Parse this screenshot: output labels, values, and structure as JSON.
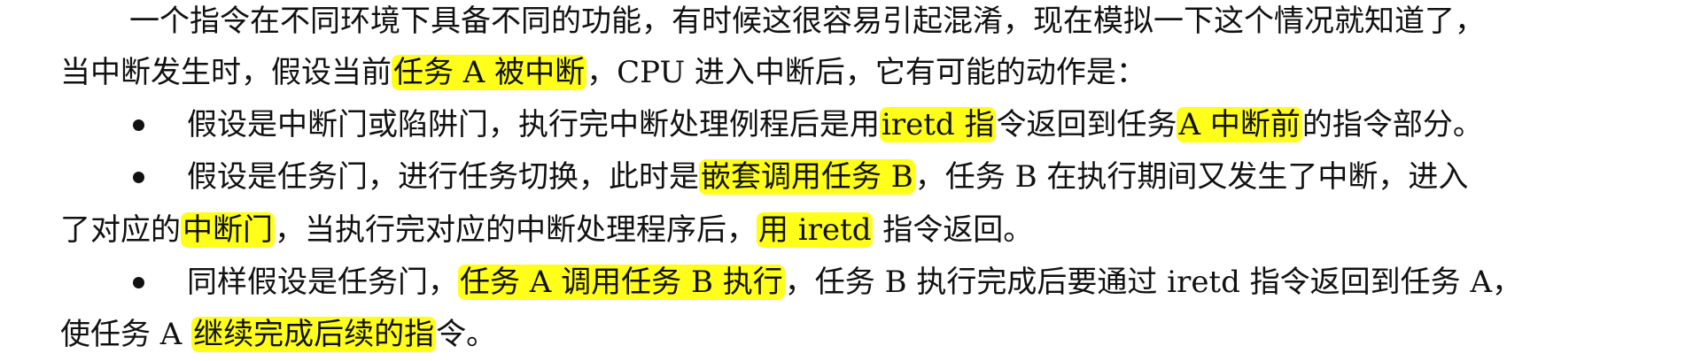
{
  "paragraph": {
    "line1": "一个指令在不同环境下具备不同的功能，有时候这很容易引起混淆，现在模拟一下这个情况就知道了，",
    "line2": {
      "a": "当中断发生时，假设当前",
      "h1": "任务 A 被中断",
      "b": "，CPU 进入中断后，它有可能的动作是："
    }
  },
  "bullets": [
    {
      "a": "假设是中断门或陷阱门，执行完中断处理例程后是用",
      "h1": "iretd 指",
      "b": "令返回到任务",
      "h2": "A 中断前",
      "c": "的指令部分。"
    },
    {
      "a": "假设是任务门，进行任务切换，此时是",
      "h1": "嵌套调用任务 B",
      "b": "，任务 B 在执行期间又发生了中断，进入",
      "cont": {
        "a": "了对应的",
        "h1": "中断门",
        "b": "，当执行完对应的中断处理程序后，",
        "h2": "用 iretd",
        "c": " 指令返回。"
      }
    },
    {
      "a": "同样假设是任务门，",
      "h1": "任务 A 调用任务 B 执行",
      "b": "，任务 B 执行完成后要通过 iretd 指令返回到任务 A，",
      "cont": {
        "a": "使任务 A ",
        "h1": "继续完成后续的指",
        "b": "令。"
      }
    }
  ],
  "colors": {
    "highlight": "#ffff1a",
    "text": "#111111"
  }
}
